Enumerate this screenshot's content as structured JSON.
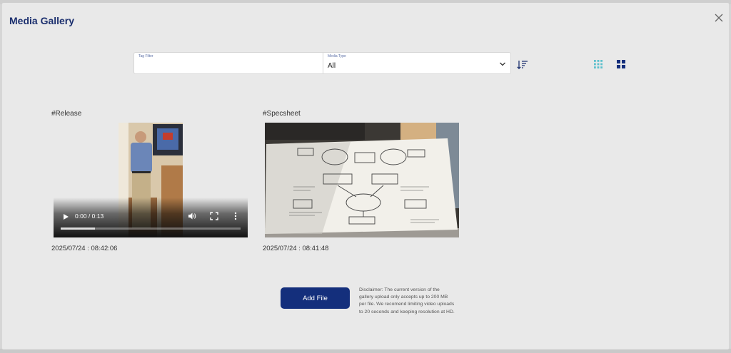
{
  "modal": {
    "title": "Media Gallery"
  },
  "filters": {
    "tag_label": "Tag Filter",
    "tag_value": "",
    "tag_placeholder": "",
    "type_label": "Media Type",
    "type_value": "All"
  },
  "icons": {
    "close": "close-icon",
    "sort": "sort-descending-icon",
    "grid_small": "grid-small-icon",
    "grid_large": "grid-large-icon",
    "play": "play-icon",
    "volume": "volume-icon",
    "fullscreen": "fullscreen-icon",
    "more": "more-vertical-icon"
  },
  "media": [
    {
      "tag": "#Release",
      "kind": "video",
      "time_display": "0:00 / 0:13",
      "progress_fraction": 0.19,
      "date": "2025/07/24 : 08:42:06"
    },
    {
      "tag": "#Specsheet",
      "kind": "image",
      "date": "2025/07/24 : 08:41:48"
    }
  ],
  "footer": {
    "add_file_label": "Add File",
    "disclaimer": "Disclaimer: The current version of the gallery upload only accepts up to 200 MB per file. We recomend limiting video uploads to 20 seconds and keeping resolution at HD."
  },
  "colors": {
    "brand_navy": "#142f7c",
    "title_navy": "#1b2f6e",
    "grid_icon_teal": "#5cc0cc",
    "modal_bg": "#e9e9e9"
  }
}
